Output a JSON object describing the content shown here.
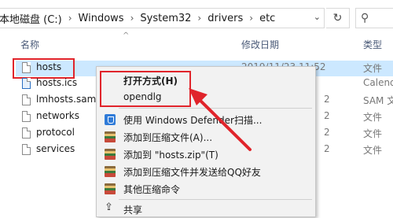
{
  "address": {
    "crumbs": [
      "本地磁盘 (C:)",
      "Windows",
      "System32",
      "drivers",
      "etc"
    ],
    "separator": "›",
    "dropdown_glyph": "⌄",
    "refresh_glyph": "↻",
    "search_glyph": "⚲"
  },
  "columns": {
    "name": "名称",
    "date": "修改日期",
    "type": "类型"
  },
  "files": [
    {
      "name": "hosts",
      "date": "2019/11/23 11:52",
      "type": "文件",
      "icon": "file-icon",
      "selected": true
    },
    {
      "name": "hosts.ics",
      "date": "",
      "type": "Calend",
      "icon": "calendar-file-icon"
    },
    {
      "name": "lmhosts.sam",
      "date": "2",
      "type": "SAM 文",
      "icon": "file-icon"
    },
    {
      "name": "networks",
      "date": "2",
      "type": "文件",
      "icon": "file-icon"
    },
    {
      "name": "protocol",
      "date": "2",
      "type": "文件",
      "icon": "file-icon"
    },
    {
      "name": "services",
      "date": "2",
      "type": "文件",
      "icon": "file-icon"
    }
  ],
  "context_menu": {
    "items": [
      {
        "label": "打开方式(H)",
        "bold": true,
        "icon": ""
      },
      {
        "label": "opendlg",
        "bold": false,
        "icon": ""
      },
      {
        "label": "使用 Windows Defender扫描...",
        "icon": "defender-shield-icon"
      },
      {
        "label": "添加到压缩文件(A)...",
        "icon": "archive-icon"
      },
      {
        "label": "添加到 \"hosts.zip\"(T)",
        "icon": "archive-icon"
      },
      {
        "label": "添加到压缩文件并发送给QQ好友",
        "icon": "archive-icon"
      },
      {
        "label": "其他压缩命令",
        "icon": "archive-icon"
      },
      {
        "label": "共享",
        "icon": "share-icon"
      }
    ]
  },
  "colors": {
    "highlight_red": "#e0242b",
    "selection_blue": "#cce8ff"
  }
}
